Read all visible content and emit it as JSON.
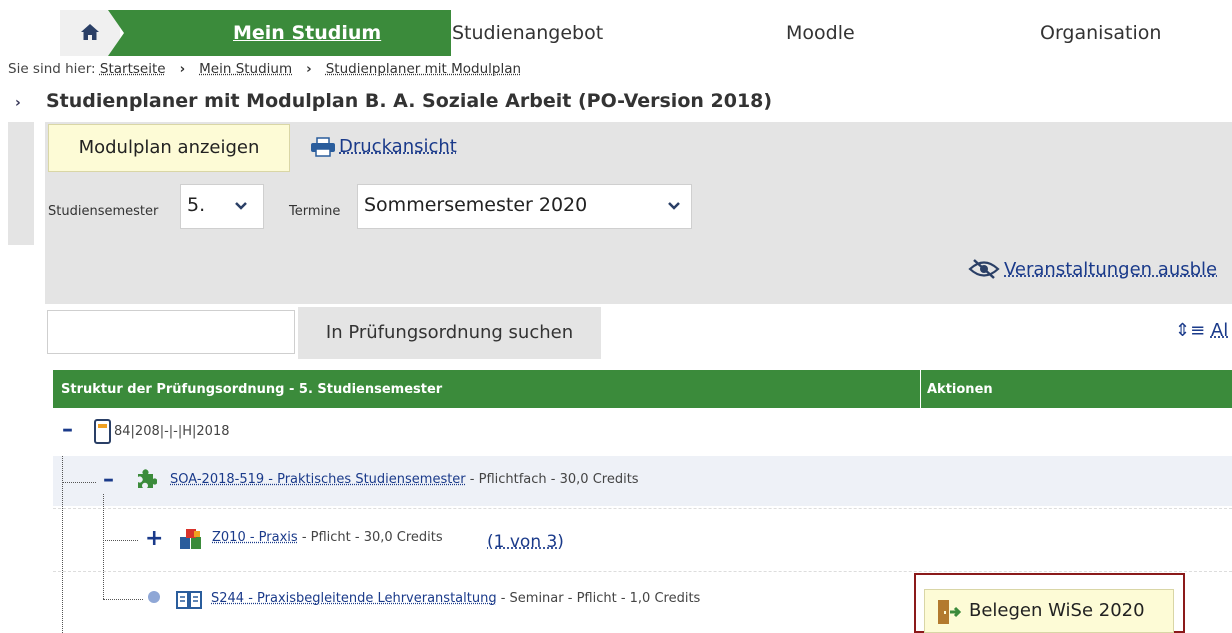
{
  "nav": {
    "home_icon": "home-icon",
    "items": [
      "Mein Studium",
      "Studienangebot",
      "Moodle",
      "Organisation"
    ]
  },
  "breadcrumb": {
    "prefix": "Sie sind hier:",
    "items": [
      "Startseite",
      "Mein Studium",
      "Studienplaner mit Modulplan"
    ]
  },
  "page": {
    "title": "Studienplaner mit Modulplan B. A. Soziale Arbeit (PO-Version 2018)"
  },
  "toolbar": {
    "modulplan_label": "Modulplan anzeigen",
    "print_label": "Druckansicht",
    "semester_label": "Studiensemester",
    "semester_value": "5.",
    "termine_label": "Termine",
    "termine_value": "Sommersemester 2020",
    "hide_label": "Veranstaltungen ausble"
  },
  "search": {
    "input_value": "",
    "button_label": "In Prüfungsordnung suchen",
    "expand_label": "Al"
  },
  "table": {
    "header_structure": "Struktur der Prüfungsordnung - 5. Studiensemester",
    "header_actions": "Aktionen",
    "rows": [
      {
        "toggle": "–",
        "link": "",
        "text": "84|208|-|-|H|2018"
      },
      {
        "toggle": "–",
        "link": "SOA-2018-519 - Praktisches Studiensemester",
        "text": " - Pflichtfach - 30,0 Credits"
      },
      {
        "toggle": "+",
        "link": "Z010 - Praxis",
        "text": " - Pflicht - 30,0 Credits",
        "extra": "(1 von 3)"
      },
      {
        "toggle": "●",
        "link": "S244 - Praxisbegleitende Lehrveranstaltung",
        "text": " - Seminar - Pflicht - 1,0 Credits"
      }
    ],
    "action_button": "Belegen WiSe 2020"
  },
  "colors": {
    "green": "#3b8b3b",
    "link": "#1a3a8a",
    "highlight_border": "#8b1a1a",
    "button_bg": "#fdfbd6"
  }
}
